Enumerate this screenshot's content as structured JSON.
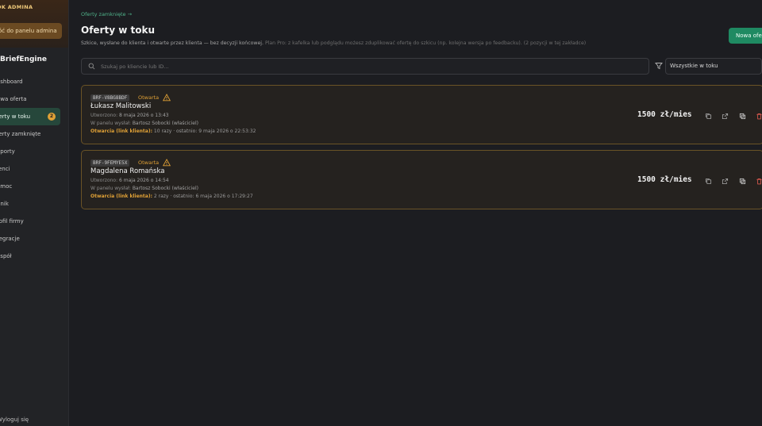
{
  "sidebar": {
    "admin_label": "OK ADMINA",
    "admin_button": "óć do panelu admina",
    "logo": "BriefEngine",
    "items": [
      {
        "label": "ashboard"
      },
      {
        "label": "owa oferta"
      },
      {
        "label": "ferty w toku",
        "badge": "2"
      },
      {
        "label": "ferty zamknięte"
      },
      {
        "label": "aporty"
      },
      {
        "label": "ienci"
      },
      {
        "label": "omoc"
      },
      {
        "label": "nnik"
      },
      {
        "label": "rofil firmy"
      },
      {
        "label": "tegracje"
      },
      {
        "label": "espół"
      }
    ],
    "logout": "Wyloguj się"
  },
  "header": {
    "breadcrumb": "Oferty zamknięte →",
    "title": "Oferty w toku",
    "subtitle": "Szkice, wysłane do klienta i otwarte przez klienta — bez decyzji końcowej.",
    "subtitle_hint": "Plan Pro: z kafelka lub podglądu możesz zduplikować ofertę do szkicu (np. kolejna wersja po feedbacku). (2 pozycji w tej zakładce)",
    "new_button": "Nowa oferta"
  },
  "search": {
    "placeholder": "Szukaj po kliencie lub ID..."
  },
  "filter": {
    "selected": "Wszystkie w toku"
  },
  "offers": [
    {
      "code": "BRF-V8BG8BDF",
      "status": "Otwarta",
      "name": "Łukasz Malitowski",
      "created_label": "Utworzono:",
      "created": "8 maja 2026 o 13:43",
      "sent_label": "W panelu wysłał:",
      "sent_by": "Bartosz Sobocki (właściciel)",
      "opens_label": "Otwarcia (link klienta):",
      "opens": "10 razy · ostatnio: 9 maja 2026 o 22:53:32",
      "price": "1500 zł/mies"
    },
    {
      "code": "BRF-9FEMYE5X",
      "status": "Otwarta",
      "name": "Magdalena Romańska",
      "created_label": "Utworzono:",
      "created": "6 maja 2026 o 14:54",
      "sent_label": "W panelu wysłał:",
      "sent_by": "Bartosz Sobocki (właściciel)",
      "opens_label": "Otwarcia (link klienta):",
      "opens": "2 razy · ostatnio: 6 maja 2026 o 17:29:27",
      "price": "1500 zł/mies"
    }
  ],
  "colors": {
    "accent": "#1f8a62",
    "warning": "#e0a136",
    "danger": "#e05a4f"
  }
}
